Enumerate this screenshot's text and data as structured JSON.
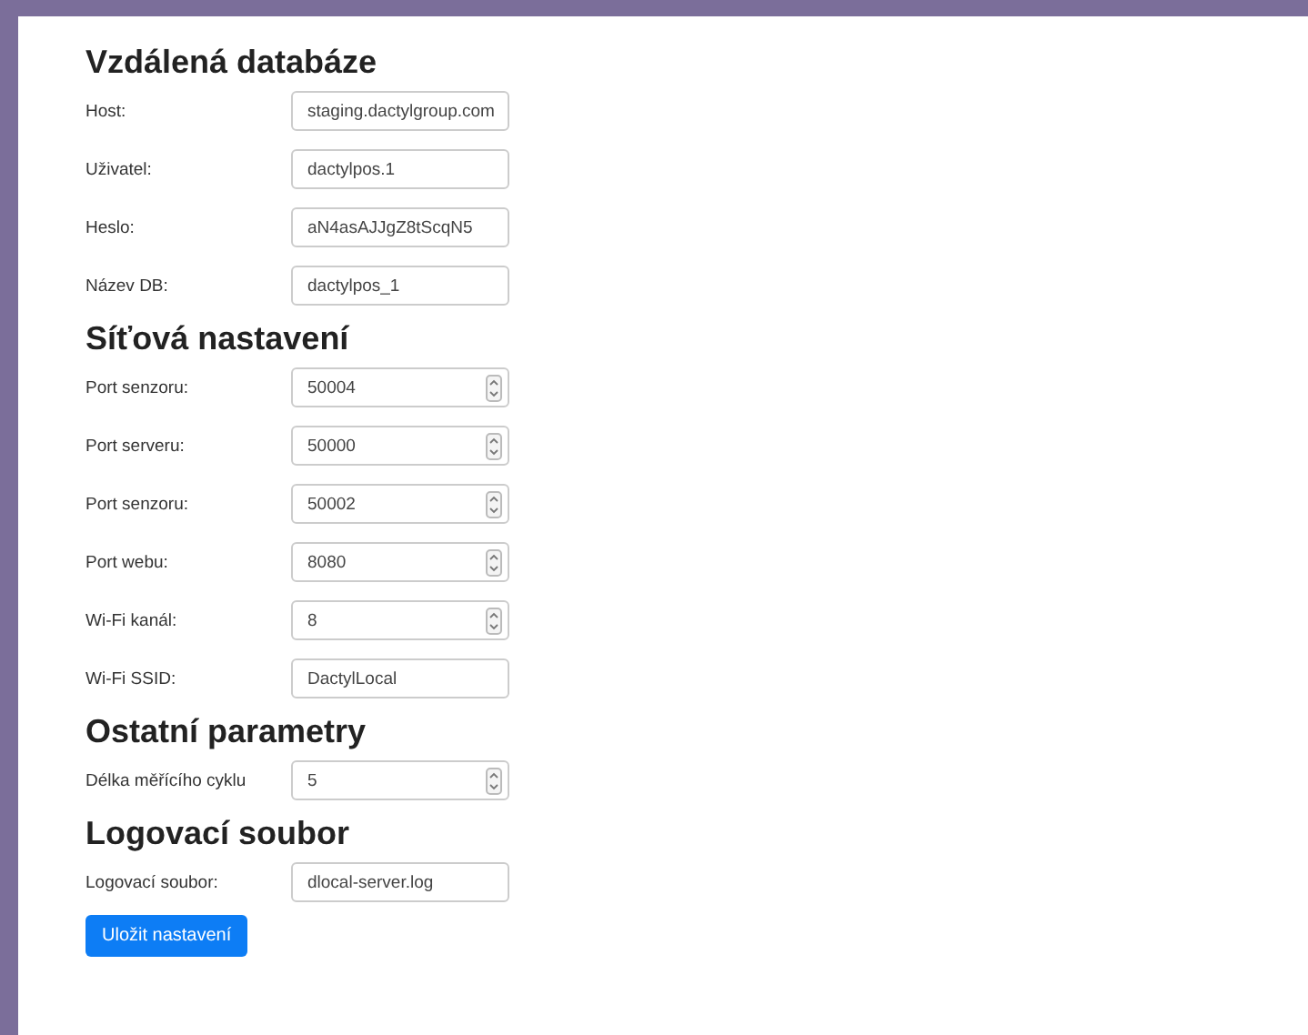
{
  "sections": [
    {
      "title": "Vzdálená databáze",
      "fields": [
        {
          "label": "Host:",
          "value": "staging.dactylgroup.com",
          "kind": "text"
        },
        {
          "label": "Uživatel:",
          "value": "dactylpos.1",
          "kind": "text"
        },
        {
          "label": "Heslo:",
          "value": "aN4asAJJgZ8tScqN5",
          "kind": "text"
        },
        {
          "label": "Název DB:",
          "value": "dactylpos_1",
          "kind": "text"
        }
      ]
    },
    {
      "title": "Síťová nastavení",
      "fields": [
        {
          "label": "Port senzoru:",
          "value": "50004",
          "kind": "number"
        },
        {
          "label": "Port serveru:",
          "value": "50000",
          "kind": "number"
        },
        {
          "label": "Port senzoru:",
          "value": "50002",
          "kind": "number"
        },
        {
          "label": "Port webu:",
          "value": "8080",
          "kind": "number"
        },
        {
          "label": "Wi-Fi kanál:",
          "value": "8",
          "kind": "number"
        },
        {
          "label": "Wi-Fi SSID:",
          "value": "DactylLocal",
          "kind": "text"
        }
      ]
    },
    {
      "title": "Ostatní parametry",
      "fields": [
        {
          "label": "Délka měřícího cyklu",
          "value": "5",
          "kind": "number"
        }
      ]
    },
    {
      "title": "Logovací soubor",
      "fields": [
        {
          "label": "Logovací soubor:",
          "value": "dlocal-server.log",
          "kind": "text"
        }
      ]
    }
  ],
  "save_button": "Uložit nastavení"
}
